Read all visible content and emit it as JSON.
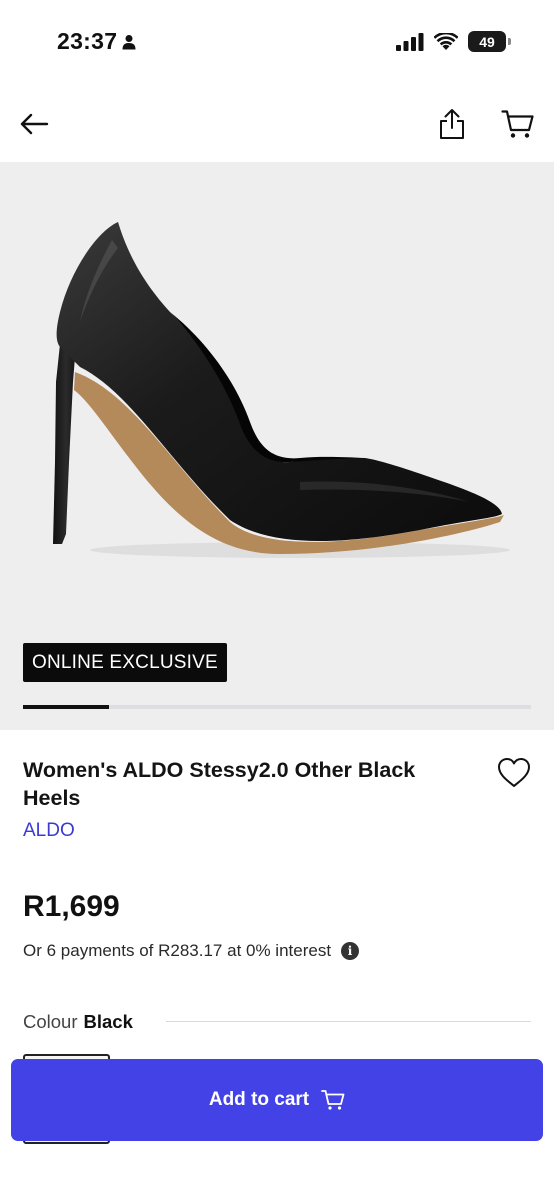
{
  "status_bar": {
    "time": "23:37",
    "battery": "49"
  },
  "nav": {
    "back_icon": "arrow-left-icon",
    "share_icon": "share-icon",
    "cart_icon": "cart-icon"
  },
  "product": {
    "badge": "ONLINE EXCLUSIVE",
    "image_carousel_progress": 0.17,
    "title": "Women's ALDO Stessy2.0 Other Black Heels",
    "brand": "ALDO",
    "price": "R1,699",
    "installments": "Or 6 payments of R283.17 at 0% interest",
    "colour_label": "Colour",
    "colour_value": "Black"
  },
  "cta": {
    "add_to_cart": "Add to cart"
  },
  "colors": {
    "accent": "#4342e6",
    "brand_link": "#3b3bd4",
    "badge_bg": "#0b0b0b",
    "hero_bg": "#efeeef"
  }
}
